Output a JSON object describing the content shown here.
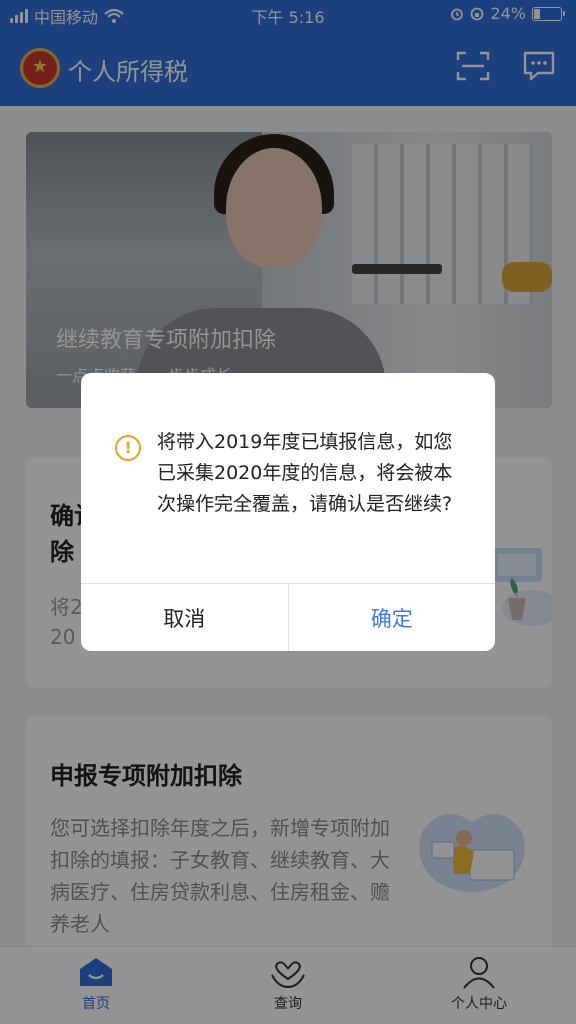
{
  "status": {
    "carrier": "中国移动",
    "time": "下午 5:16",
    "battery": "24%",
    "battery_level": 0.24
  },
  "header": {
    "title": "个人所得税",
    "scan_icon": "scan-icon",
    "message_icon": "message-icon"
  },
  "banner": {
    "title": "继续教育专项附加扣除",
    "subtitle": "一点点收获，一步步成长"
  },
  "card1": {
    "title": "确认除",
    "desc": "将2 20"
  },
  "card2": {
    "title": "申报专项附加扣除",
    "desc": "您可选择扣除年度之后，新增专项附加扣除的填报：子女教育、继续教育、大病医疗、住房贷款利息、住房租金、赡养老人"
  },
  "tabs": [
    {
      "label": "首页",
      "icon": "home-icon"
    },
    {
      "label": "查询",
      "icon": "heart-hand-icon"
    },
    {
      "label": "个人中心",
      "icon": "user-icon"
    }
  ],
  "dialog": {
    "message": "将带入2019年度已填报信息，如您已采集2020年度的信息，将会被本次操作完全覆盖，请确认是否继续?",
    "cancel": "取消",
    "confirm": "确定",
    "accent": "#3c7be0",
    "warn_color": "#f0a227"
  }
}
